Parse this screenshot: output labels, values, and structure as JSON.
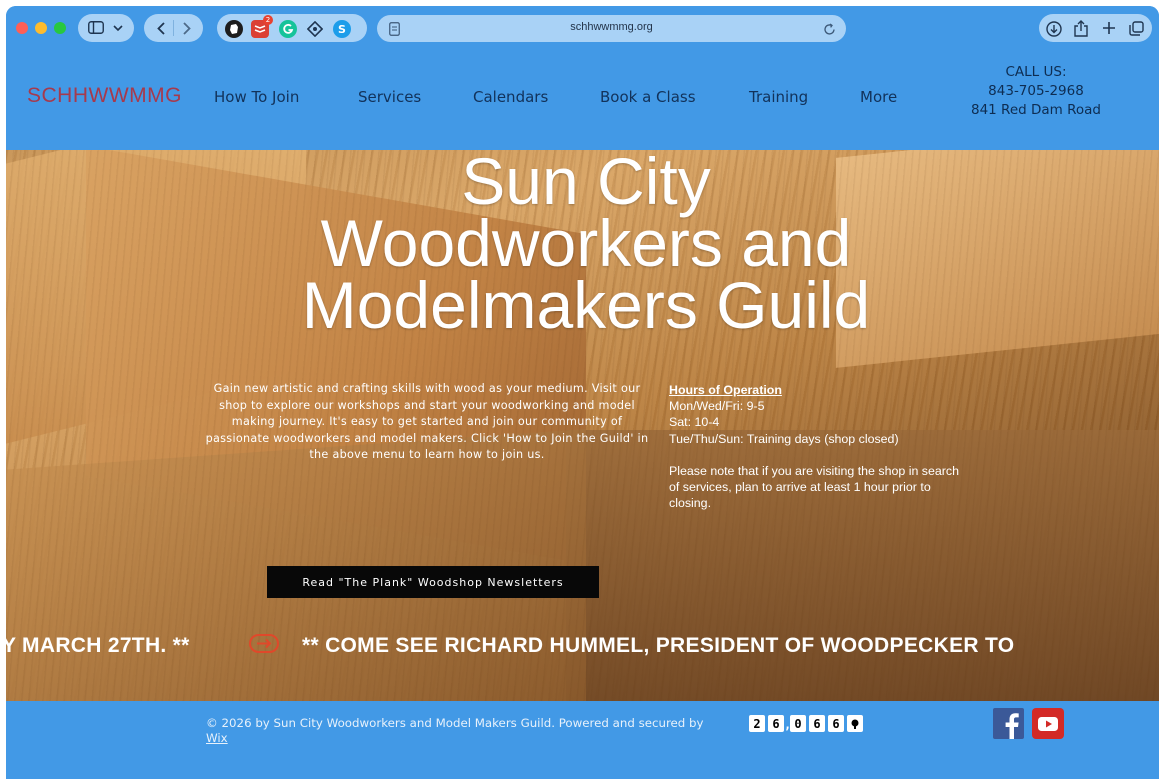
{
  "browser": {
    "url": "schhwwmmg.org",
    "badge_count": "2",
    "icons": [
      "sidebar-icon",
      "chevron-down-icon",
      "back-icon",
      "forward-icon",
      "evernote-icon",
      "todoist-icon",
      "grammarly-icon",
      "extension-icon",
      "skype-icon",
      "page-icon",
      "reload-icon",
      "download-icon",
      "share-icon",
      "new-tab-icon",
      "tabs-icon"
    ]
  },
  "header": {
    "logo": "SCHHWWMMG",
    "nav": [
      "How To Join",
      "Services",
      "Calendars",
      "Book a Class",
      "Training",
      "More"
    ],
    "contact": {
      "label": "CALL US:",
      "phone": "843-705-2968",
      "address": "841 Red Dam Road"
    }
  },
  "hero": {
    "title_lines": [
      "Sun City",
      "Woodworkers and",
      "Modelmakers Guild"
    ],
    "intro": "Gain new artistic and crafting skills with wood as your medium.  Visit our shop to explore our workshops and start your woodworking and model making journey. It's easy to get started and join our community of passionate woodworkers and model makers.  Click 'How to Join the Guild' in the above menu to learn how to join us.",
    "hours": {
      "title": "Hours of Operation",
      "lines": [
        "Mon/Wed/Fri: 9-5",
        "Sat: 10-4",
        "Tue/Thu/Sun: Training days (shop closed)"
      ],
      "note": "Please note that if you are visiting the shop in search of services, plan to arrive at least 1 hour prior to closing."
    },
    "button_label": "Read \"The Plank\" Woodshop Newsletters",
    "ticker_left": "Y MARCH 27TH. **",
    "ticker_right": "** COME SEE RICHARD HUMMEL, PRESIDENT OF WOODPECKER TO"
  },
  "footer": {
    "copyright": "© 2026 by Sun City Woodworkers and Model Makers Guild. Powered and secured by",
    "wix": "Wix",
    "counter_digits": [
      "2",
      "6",
      "0",
      "6",
      "6"
    ],
    "counter_separator": ","
  },
  "colors": {
    "brand_blue": "#4299e6",
    "logo": "#a63a4d",
    "nav_text": "#12325a",
    "button_bg": "#080808",
    "facebook": "#3b5998",
    "youtube": "#d32a26"
  }
}
